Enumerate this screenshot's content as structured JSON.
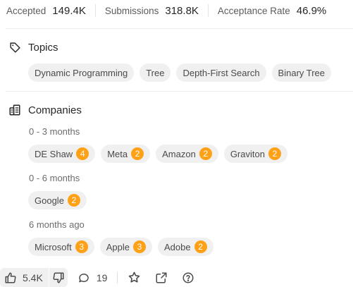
{
  "stats": [
    {
      "label": "Accepted",
      "value": "149.4K"
    },
    {
      "label": "Submissions",
      "value": "318.8K"
    },
    {
      "label": "Acceptance Rate",
      "value": "46.9%"
    }
  ],
  "topics": {
    "title": "Topics",
    "tags": [
      "Dynamic Programming",
      "Tree",
      "Depth-First Search",
      "Binary Tree"
    ]
  },
  "companies": {
    "title": "Companies",
    "groups": [
      {
        "period": "0 - 3 months",
        "items": [
          {
            "name": "DE Shaw",
            "count": "4"
          },
          {
            "name": "Meta",
            "count": "2"
          },
          {
            "name": "Amazon",
            "count": "2"
          },
          {
            "name": "Graviton",
            "count": "2"
          }
        ]
      },
      {
        "period": "0 - 6 months",
        "items": [
          {
            "name": "Google",
            "count": "2"
          }
        ]
      },
      {
        "period": "6 months ago",
        "items": [
          {
            "name": "Microsoft",
            "count": "3"
          },
          {
            "name": "Apple",
            "count": "3"
          },
          {
            "name": "Adobe",
            "count": "2"
          }
        ]
      }
    ]
  },
  "footer": {
    "likes": "5.4K",
    "comments": "19"
  },
  "icons": {
    "topics": "tag-icon",
    "companies": "building-icon",
    "like": "thumbs-up-icon",
    "dislike": "thumbs-down-icon",
    "comment": "comment-icon",
    "favorite": "star-icon",
    "share": "external-link-icon",
    "help": "question-circle-icon"
  },
  "colors": {
    "badge": "#ffa116",
    "chip_bg": "#f0f0f0"
  }
}
